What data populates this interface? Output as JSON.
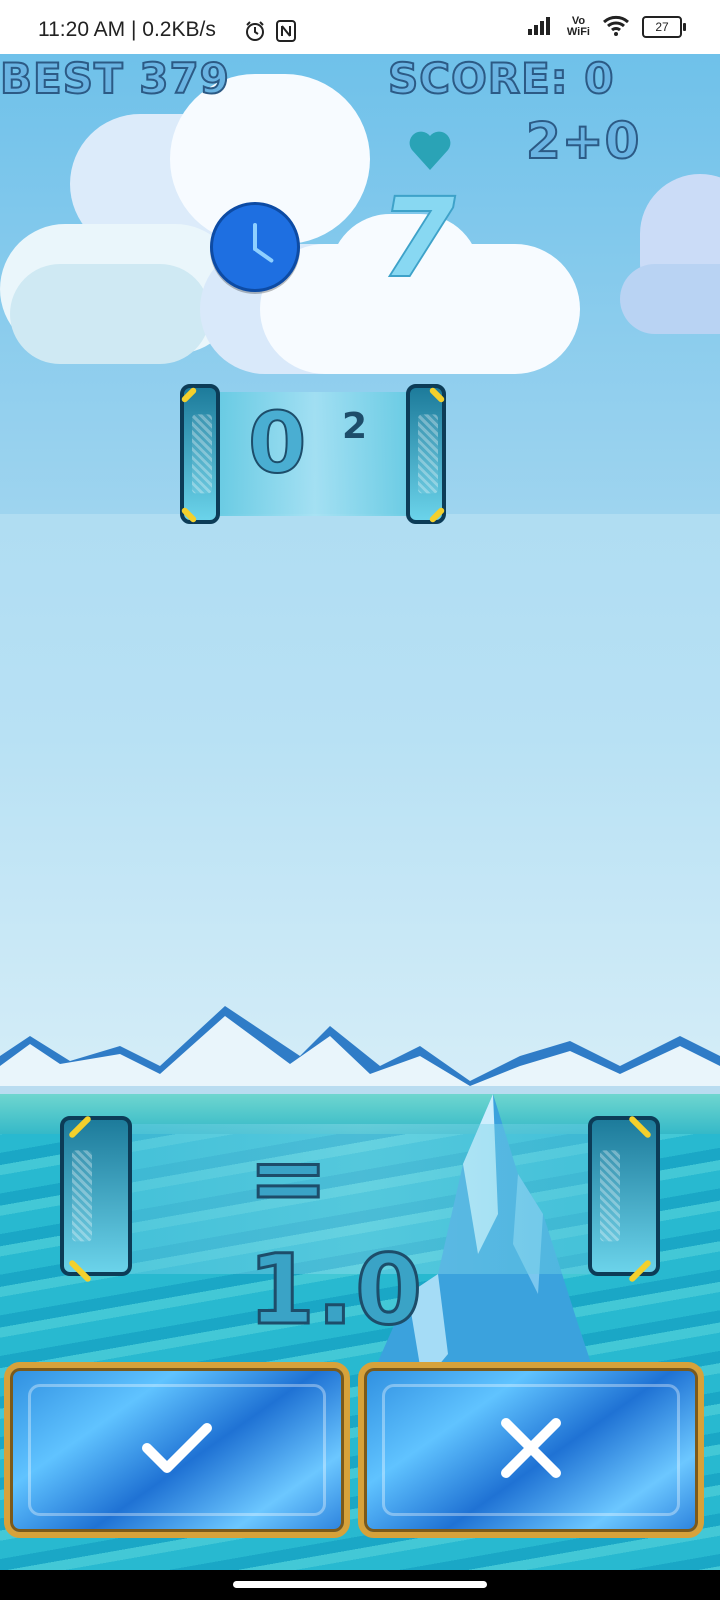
{
  "status_bar": {
    "time": "11:20 AM | 0.2KB/s",
    "icons": [
      "alarm-icon",
      "nfc-icon",
      "signal-icon",
      "vowifi-icon",
      "wifi-icon"
    ],
    "vowifi_top": "Vo",
    "vowifi_bottom": "WiFi",
    "battery": "27"
  },
  "hud": {
    "best": "BEST 379",
    "score": "SCORE: 0",
    "combo": "2+0",
    "timer_value": "7",
    "icons": [
      "clock-icon",
      "heart-icon"
    ]
  },
  "question": {
    "base": "0",
    "exponent": "2"
  },
  "answer": {
    "text": "= 1.0"
  },
  "buttons": {
    "confirm_icon": "check-icon",
    "reject_icon": "cross-icon"
  },
  "colors": {
    "hud_text": "#6ab4e3",
    "button_border": "#d7a23a",
    "timer_clock": "#1e6fe1",
    "heart": "#2aa3b6"
  }
}
